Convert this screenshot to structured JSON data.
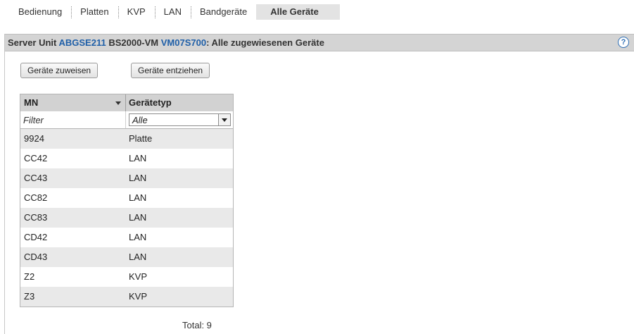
{
  "tabs": [
    {
      "label": "Bedienung",
      "active": false
    },
    {
      "label": "Platten",
      "active": false
    },
    {
      "label": "KVP",
      "active": false
    },
    {
      "label": "LAN",
      "active": false
    },
    {
      "label": "Bandgeräte",
      "active": false
    },
    {
      "label": "Alle Geräte",
      "active": true
    }
  ],
  "header": {
    "prefix": "Server Unit ",
    "server_unit": "ABGSE211",
    "middle": " BS2000-VM ",
    "vm": "VM07S700",
    "suffix": ": Alle zugewiesenen Geräte",
    "help_icon": "?"
  },
  "buttons": {
    "assign": "Geräte zuweisen",
    "remove": "Geräte entziehen"
  },
  "table": {
    "columns": [
      "MN",
      "Gerätetyp"
    ],
    "filter_placeholder": "Filter",
    "type_filter_value": "Alle",
    "rows": [
      [
        "9924",
        "Platte"
      ],
      [
        "CC42",
        "LAN"
      ],
      [
        "CC43",
        "LAN"
      ],
      [
        "CC82",
        "LAN"
      ],
      [
        "CC83",
        "LAN"
      ],
      [
        "CD42",
        "LAN"
      ],
      [
        "CD43",
        "LAN"
      ],
      [
        "Z2",
        "KVP"
      ],
      [
        "Z3",
        "KVP"
      ]
    ],
    "total": "Total: 9"
  },
  "colors": {
    "link": "#1f5fa8",
    "header_bg": "#d4d4d4",
    "active_tab_bg": "#e3e3e3",
    "row_alt": "#e9e9e9"
  }
}
